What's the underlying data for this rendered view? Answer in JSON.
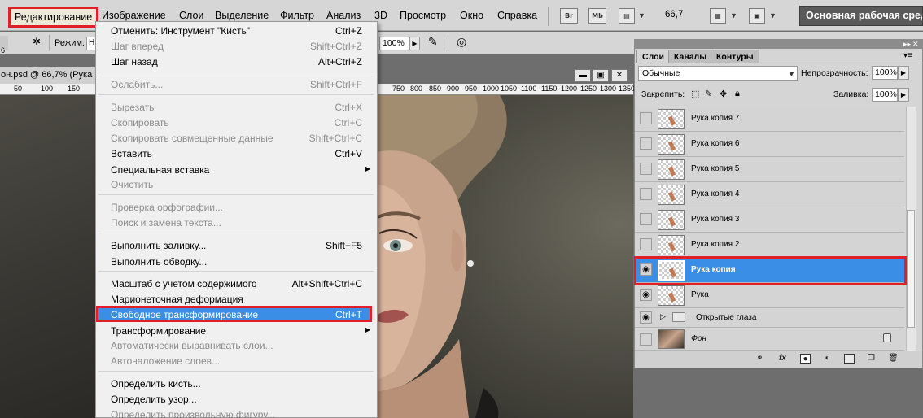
{
  "menubar": {
    "items": [
      "Редактирование",
      "Изображение",
      "Слои",
      "Выделение",
      "Фильтр",
      "Анализ",
      "3D",
      "Просмотр",
      "Окно",
      "Справка"
    ],
    "br_label": "Br",
    "mb_label": "Mb",
    "zoom": "66,7",
    "workspace": "Основная рабочая среда"
  },
  "options": {
    "mode_label": "Режим:",
    "mode_value": "Н",
    "flow_value": "100%",
    "left_num": "6"
  },
  "document": {
    "tab_title": "он.psd @ 66,7% (Рука",
    "ruler_left": [
      "50",
      "100",
      "150"
    ],
    "ruler_right": [
      "750",
      "800",
      "850",
      "900",
      "950",
      "1000",
      "1050",
      "1100",
      "1150",
      "1200",
      "1250",
      "1300",
      "1350"
    ]
  },
  "edit_menu": {
    "items": [
      {
        "label": "Отменить: Инструмент \"Кисть\"",
        "shortcut": "Ctrl+Z",
        "enabled": true
      },
      {
        "label": "Шаг вперед",
        "shortcut": "Shift+Ctrl+Z",
        "enabled": false
      },
      {
        "label": "Шаг назад",
        "shortcut": "Alt+Ctrl+Z",
        "enabled": true
      },
      {
        "label": "Ослабить...",
        "shortcut": "Shift+Ctrl+F",
        "enabled": false
      },
      {
        "label": "Вырезать",
        "shortcut": "Ctrl+X",
        "enabled": false
      },
      {
        "label": "Скопировать",
        "shortcut": "Ctrl+C",
        "enabled": false
      },
      {
        "label": "Скопировать совмещенные данные",
        "shortcut": "Shift+Ctrl+C",
        "enabled": false
      },
      {
        "label": "Вставить",
        "shortcut": "Ctrl+V",
        "enabled": true
      },
      {
        "label": "Специальная вставка",
        "shortcut": "",
        "enabled": true
      },
      {
        "label": "Очистить",
        "shortcut": "",
        "enabled": false
      },
      {
        "label": "Проверка орфографии...",
        "shortcut": "",
        "enabled": false
      },
      {
        "label": "Поиск и замена текста...",
        "shortcut": "",
        "enabled": false
      },
      {
        "label": "Выполнить заливку...",
        "shortcut": "Shift+F5",
        "enabled": true
      },
      {
        "label": "Выполнить обводку...",
        "shortcut": "",
        "enabled": true
      },
      {
        "label": "Масштаб с учетом содержимого",
        "shortcut": "Alt+Shift+Ctrl+C",
        "enabled": true
      },
      {
        "label": "Марионеточная деформация",
        "shortcut": "",
        "enabled": true
      },
      {
        "label": "Свободное трансформирование",
        "shortcut": "Ctrl+T",
        "enabled": true
      },
      {
        "label": "Трансформирование",
        "shortcut": "",
        "enabled": true
      },
      {
        "label": "Автоматически выравнивать слои...",
        "shortcut": "",
        "enabled": false
      },
      {
        "label": "Автоналожение слоев...",
        "shortcut": "",
        "enabled": false
      },
      {
        "label": "Определить кисть...",
        "shortcut": "",
        "enabled": true
      },
      {
        "label": "Определить узор...",
        "shortcut": "",
        "enabled": true
      },
      {
        "label": "Определить произвольную фигуру...",
        "shortcut": "",
        "enabled": false
      }
    ]
  },
  "layers_panel": {
    "tabs": [
      "Слои",
      "Каналы",
      "Контуры"
    ],
    "blend_mode": "Обычные",
    "opacity_label": "Непрозрачность:",
    "opacity_value": "100%",
    "lock_label": "Закрепить:",
    "fill_label": "Заливка:",
    "fill_value": "100%",
    "layers": [
      {
        "name": "Рука копия 7",
        "visible": false,
        "selected": false
      },
      {
        "name": "Рука копия 6",
        "visible": false,
        "selected": false
      },
      {
        "name": "Рука копия 5",
        "visible": false,
        "selected": false
      },
      {
        "name": "Рука копия 4",
        "visible": false,
        "selected": false
      },
      {
        "name": "Рука копия 3",
        "visible": false,
        "selected": false
      },
      {
        "name": "Рука копия 2",
        "visible": false,
        "selected": false
      },
      {
        "name": "Рука копия",
        "visible": true,
        "selected": true
      },
      {
        "name": "Рука",
        "visible": true,
        "selected": false
      },
      {
        "name": "Открытые глаза",
        "visible": true,
        "selected": false,
        "group": true
      },
      {
        "name": "Фон",
        "visible": false,
        "selected": false,
        "locked": true
      }
    ],
    "footer_icons": [
      "link-icon",
      "fx-icon",
      "mask-icon",
      "adjustment-icon",
      "group-icon",
      "new-layer-icon",
      "trash-icon"
    ]
  },
  "colors": {
    "highlight": "#3a8ee6",
    "annotation_red": "#e21f26",
    "panel_bg": "#d5d5d5"
  }
}
